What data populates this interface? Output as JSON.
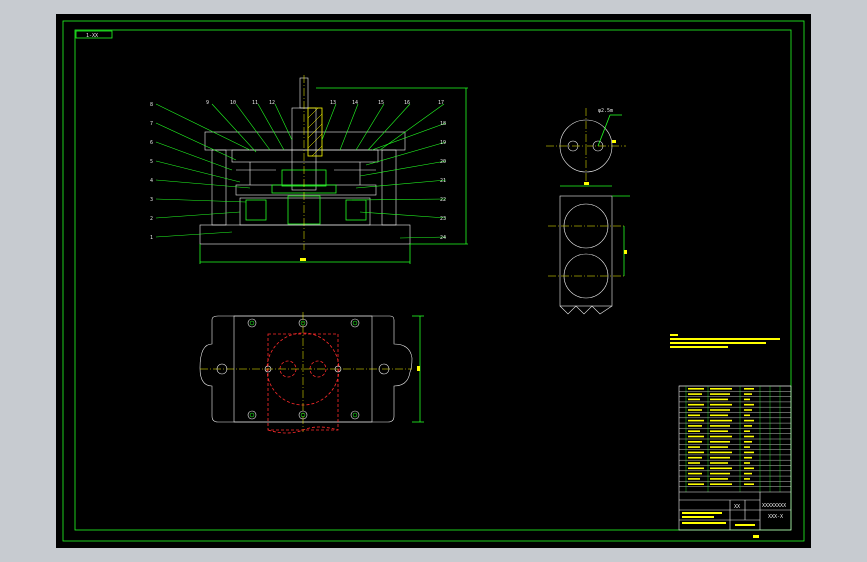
{
  "sheet": {
    "corner_tag": "1-XX",
    "title_block_name": "XXXXXXXX",
    "title_block_code": "XXX-X",
    "material_mark": "XX"
  },
  "section_labels": {
    "left": [
      "8",
      "7",
      "6",
      "5",
      "4",
      "3",
      "2",
      "1"
    ],
    "top": [
      "9",
      "10",
      "11",
      "12",
      "13",
      "14",
      "15",
      "16",
      "17"
    ],
    "right": [
      "18",
      "19",
      "20",
      "21",
      "22",
      "23",
      "24"
    ]
  },
  "part_view_note": "φ2.5m",
  "colors": {
    "background": "#000000",
    "frame": "#22ff22",
    "outline": "#f0f0f0",
    "hidden": "#ff2b2b",
    "annotation": "#ffff00",
    "viewport": "#c7cbd0"
  }
}
